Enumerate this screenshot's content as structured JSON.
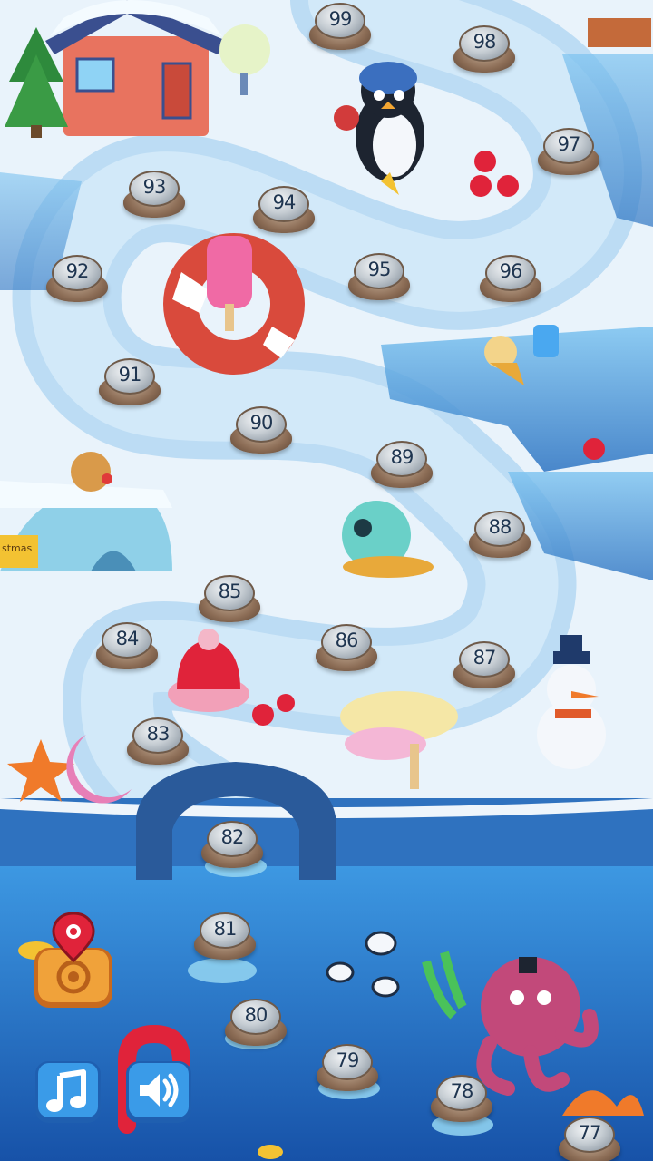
{
  "levels": [
    {
      "label": "99"
    },
    {
      "label": "98"
    },
    {
      "label": "97"
    },
    {
      "label": "93"
    },
    {
      "label": "94"
    },
    {
      "label": "92"
    },
    {
      "label": "95"
    },
    {
      "label": "96"
    },
    {
      "label": "91"
    },
    {
      "label": "90"
    },
    {
      "label": "89"
    },
    {
      "label": "88"
    },
    {
      "label": "85"
    },
    {
      "label": "84"
    },
    {
      "label": "86"
    },
    {
      "label": "87"
    },
    {
      "label": "83"
    },
    {
      "label": "82"
    },
    {
      "label": "81"
    },
    {
      "label": "80"
    },
    {
      "label": "79"
    },
    {
      "label": "78"
    },
    {
      "label": "77"
    }
  ],
  "scenery": {
    "igloo_sign": "stmas"
  },
  "controls": {
    "locate_icon": "map-pin-target-icon",
    "music_icon": "music-note-icon",
    "sound_icon": "speaker-icon"
  },
  "colors": {
    "snow": "#eef5fb",
    "path": "#b9dcf5",
    "water": "#1f6cc6",
    "button_blue": "#3a9be8",
    "button_orange": "#f0a23a"
  }
}
